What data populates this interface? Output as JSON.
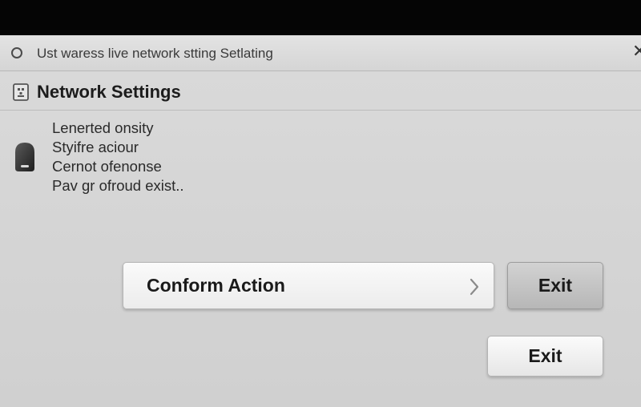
{
  "window": {
    "title": "Ust waress live network stting Setlating"
  },
  "header": {
    "title": "Network Settings"
  },
  "description": {
    "lines": [
      "Lenerted onsity",
      "Styifre aciour",
      "Cernot ofenonse",
      "Pav gr ofroud exist.."
    ]
  },
  "actions": {
    "confirm_label": "Conform Action",
    "exit_label": "Exit",
    "exit_secondary_label": "Exit"
  },
  "icons": {
    "title": "circle-icon",
    "close": "close-icon",
    "header": "document-icon",
    "device": "device-icon",
    "chevron": "chevron-right-icon"
  },
  "colors": {
    "window_bg": "#d6d6d6",
    "text_primary": "#1a1a1a",
    "bezel": "#050505"
  }
}
